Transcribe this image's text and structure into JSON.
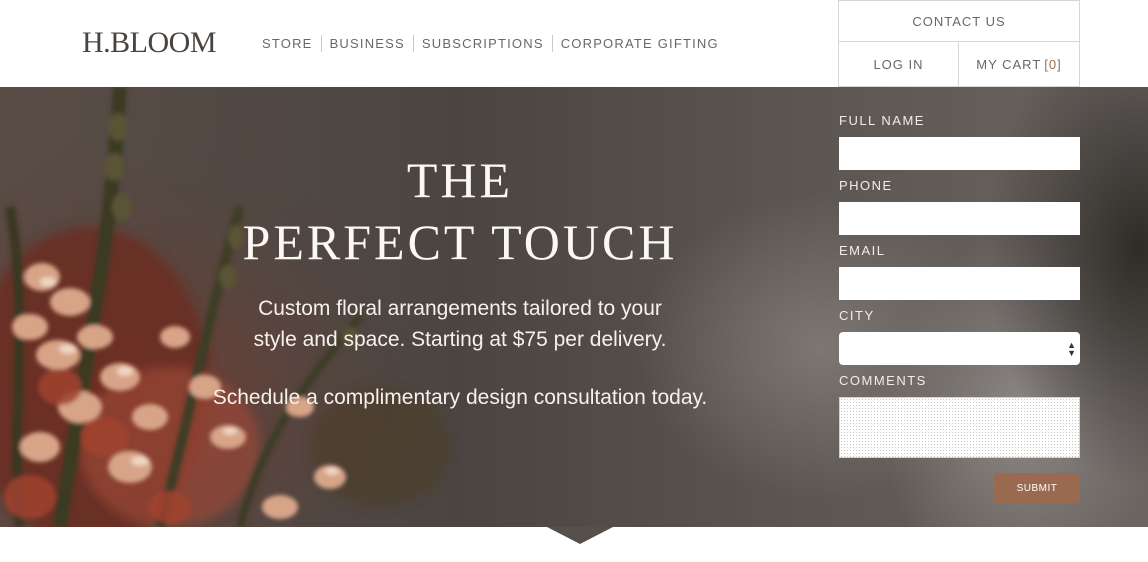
{
  "header": {
    "logo": "H.BLOOM",
    "nav": [
      "STORE",
      "BUSINESS",
      "SUBSCRIPTIONS",
      "CORPORATE GIFTING"
    ],
    "contact_label": "CONTACT US",
    "login_label": "LOG IN",
    "cart_label": "MY CART",
    "cart_count": "[0]"
  },
  "hero": {
    "title_line1": "THE",
    "title_line2": "PERFECT TOUCH",
    "subtitle_line1": "Custom floral arrangements tailored to your",
    "subtitle_line2": "style and space. Starting at $75 per delivery.",
    "cta": "Schedule a complimentary design consultation today."
  },
  "form": {
    "full_name_label": "FULL NAME",
    "phone_label": "PHONE",
    "email_label": "EMAIL",
    "city_label": "CITY",
    "comments_label": "COMMENTS",
    "submit_label": "SUBMIT",
    "full_name_value": "",
    "phone_value": "",
    "email_value": "",
    "city_value": ""
  },
  "colors": {
    "accent": "#9a6a50",
    "text_dark": "#4a4440"
  }
}
